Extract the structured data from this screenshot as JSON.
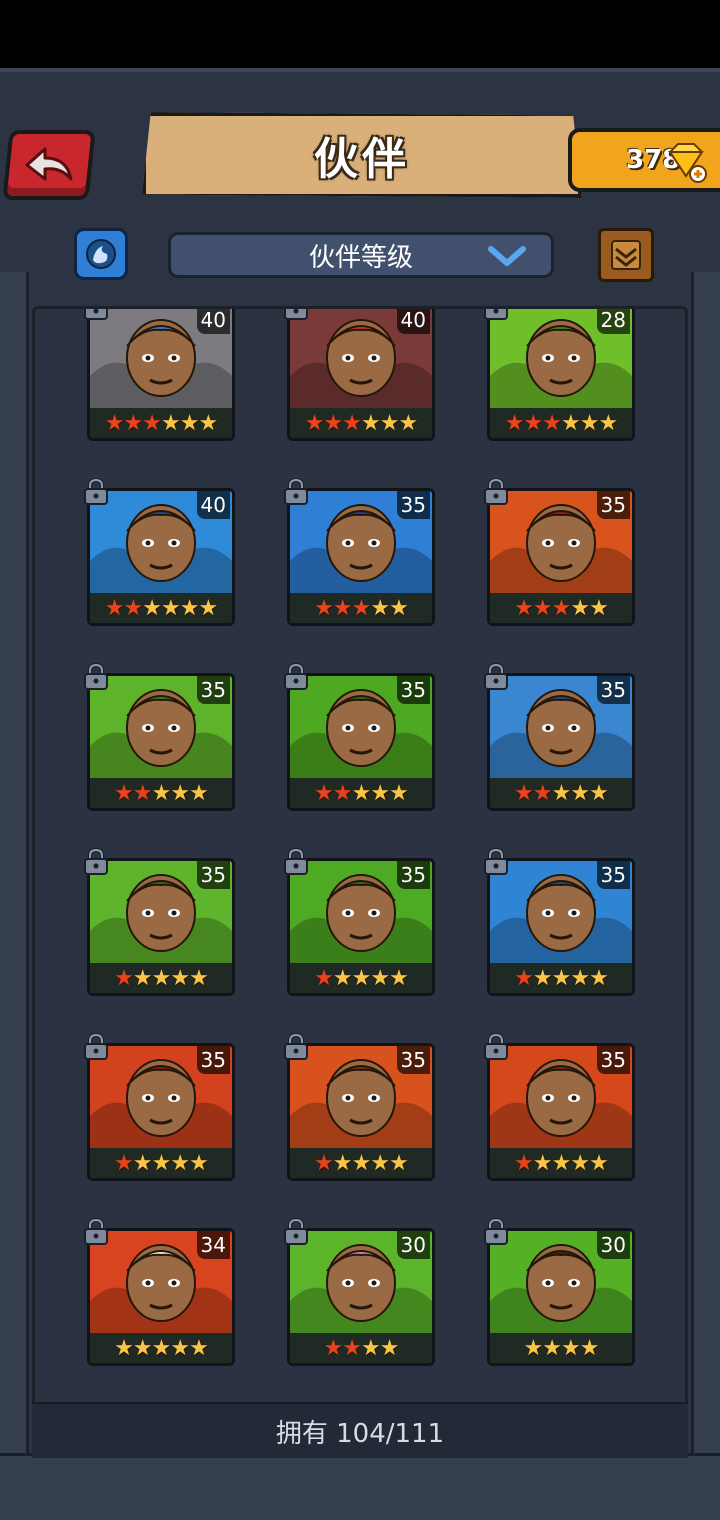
{
  "header": {
    "title": "伙伴",
    "gem_count": "378",
    "back_icon": "back-arrow-icon",
    "gem_icon": "diamond-plus-icon"
  },
  "toolbar": {
    "filter_icon": "element-filter-icon",
    "sort_label": "伙伴等级",
    "sort_icon": "chevron-down-icon",
    "scroll_icon": "scroll-icon"
  },
  "companions": [
    {
      "level": "40",
      "stars": 6,
      "red_stars": 3,
      "theme": "#7d7b80",
      "accent": "#3a7fd0"
    },
    {
      "level": "40",
      "stars": 6,
      "red_stars": 3,
      "theme": "#7a3a3a",
      "accent": "#c7342a"
    },
    {
      "level": "28",
      "stars": 6,
      "red_stars": 3,
      "theme": "#6fbf2a",
      "accent": "#3d8a1a"
    },
    {
      "level": "40",
      "stars": 6,
      "red_stars": 2,
      "theme": "#2f8ad8",
      "accent": "#1b4e8a"
    },
    {
      "level": "35",
      "stars": 5,
      "red_stars": 3,
      "theme": "#2f7fd6",
      "accent": "#1c3f8a"
    },
    {
      "level": "35",
      "stars": 5,
      "red_stars": 3,
      "theme": "#d9531c",
      "accent": "#8a1f1a"
    },
    {
      "level": "35",
      "stars": 5,
      "red_stars": 2,
      "theme": "#5fb32a",
      "accent": "#3a7f1a"
    },
    {
      "level": "35",
      "stars": 5,
      "red_stars": 2,
      "theme": "#4fa821",
      "accent": "#2f6a16"
    },
    {
      "level": "35",
      "stars": 5,
      "red_stars": 2,
      "theme": "#3a86d1",
      "accent": "#244f80"
    },
    {
      "level": "35",
      "stars": 5,
      "red_stars": 1,
      "theme": "#5eb42b",
      "accent": "#2f6a16"
    },
    {
      "level": "35",
      "stars": 5,
      "red_stars": 1,
      "theme": "#4faa23",
      "accent": "#2f6a16"
    },
    {
      "level": "35",
      "stars": 5,
      "red_stars": 1,
      "theme": "#2f84d4",
      "accent": "#1c4a80"
    },
    {
      "level": "35",
      "stars": 5,
      "red_stars": 1,
      "theme": "#d2421e",
      "accent": "#7a1e12"
    },
    {
      "level": "35",
      "stars": 5,
      "red_stars": 1,
      "theme": "#d8521d",
      "accent": "#7a2a12"
    },
    {
      "level": "35",
      "stars": 5,
      "red_stars": 1,
      "theme": "#d4481c",
      "accent": "#7a2412"
    },
    {
      "level": "34",
      "stars": 5,
      "red_stars": 0,
      "theme": "#d8441f",
      "accent": "#e8e6e0"
    },
    {
      "level": "30",
      "stars": 4,
      "red_stars": 2,
      "theme": "#5cb42a",
      "accent": "#d779c4"
    },
    {
      "level": "30",
      "stars": 4,
      "red_stars": 0,
      "theme": "#55b026",
      "accent": "#3a2a1a"
    }
  ],
  "footer": {
    "owned_label": "拥有 104/111"
  },
  "lock_icon": "padlock-icon"
}
